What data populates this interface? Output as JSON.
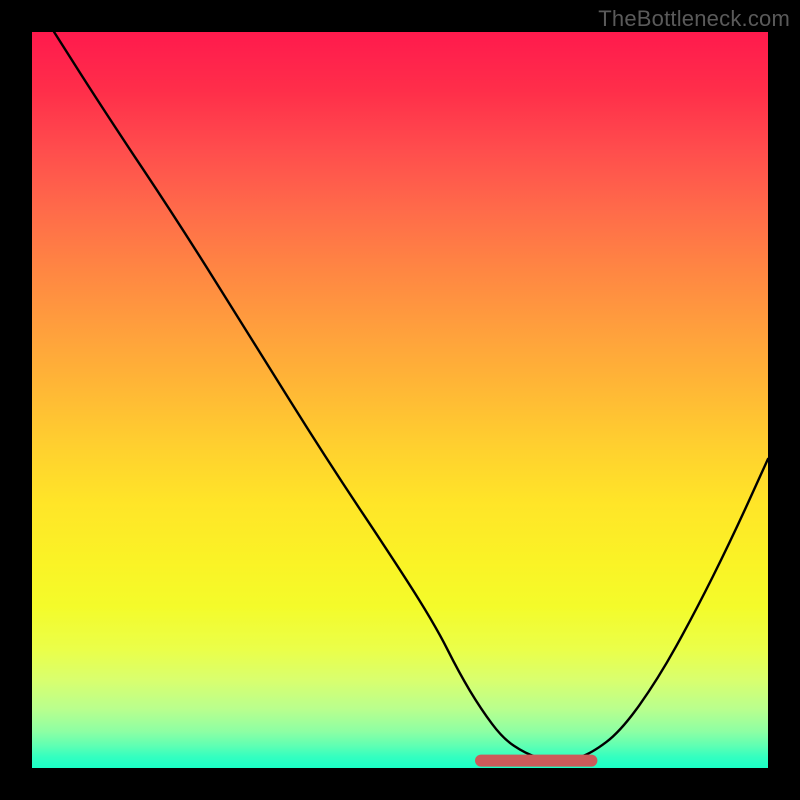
{
  "watermark": {
    "text": "TheBottleneck.com"
  },
  "chart_data": {
    "type": "line",
    "title": "",
    "xlabel": "",
    "ylabel": "",
    "xlim": [
      0,
      100
    ],
    "ylim": [
      0,
      100
    ],
    "grid": false,
    "legend": false,
    "series": [
      {
        "name": "bottleneck-curve",
        "x": [
          3,
          10,
          20,
          30,
          40,
          50,
          55,
          58,
          61,
          64,
          67,
          70,
          73,
          76,
          80,
          85,
          90,
          95,
          100
        ],
        "values": [
          100,
          89,
          74,
          58,
          42,
          27,
          19,
          13,
          8,
          4,
          2,
          1,
          1,
          2,
          5,
          12,
          21,
          31,
          42
        ]
      }
    ],
    "flat_segment": {
      "x_start": 61,
      "x_end": 76,
      "y": 1,
      "color": "#cc5a5a",
      "thickness_px": 12
    },
    "background_gradient": {
      "stops": [
        {
          "pos": 0,
          "color": "#ff1a4d"
        },
        {
          "pos": 50,
          "color": "#ffb636"
        },
        {
          "pos": 80,
          "color": "#f4fb2a"
        },
        {
          "pos": 100,
          "color": "#1affc6"
        }
      ]
    }
  }
}
